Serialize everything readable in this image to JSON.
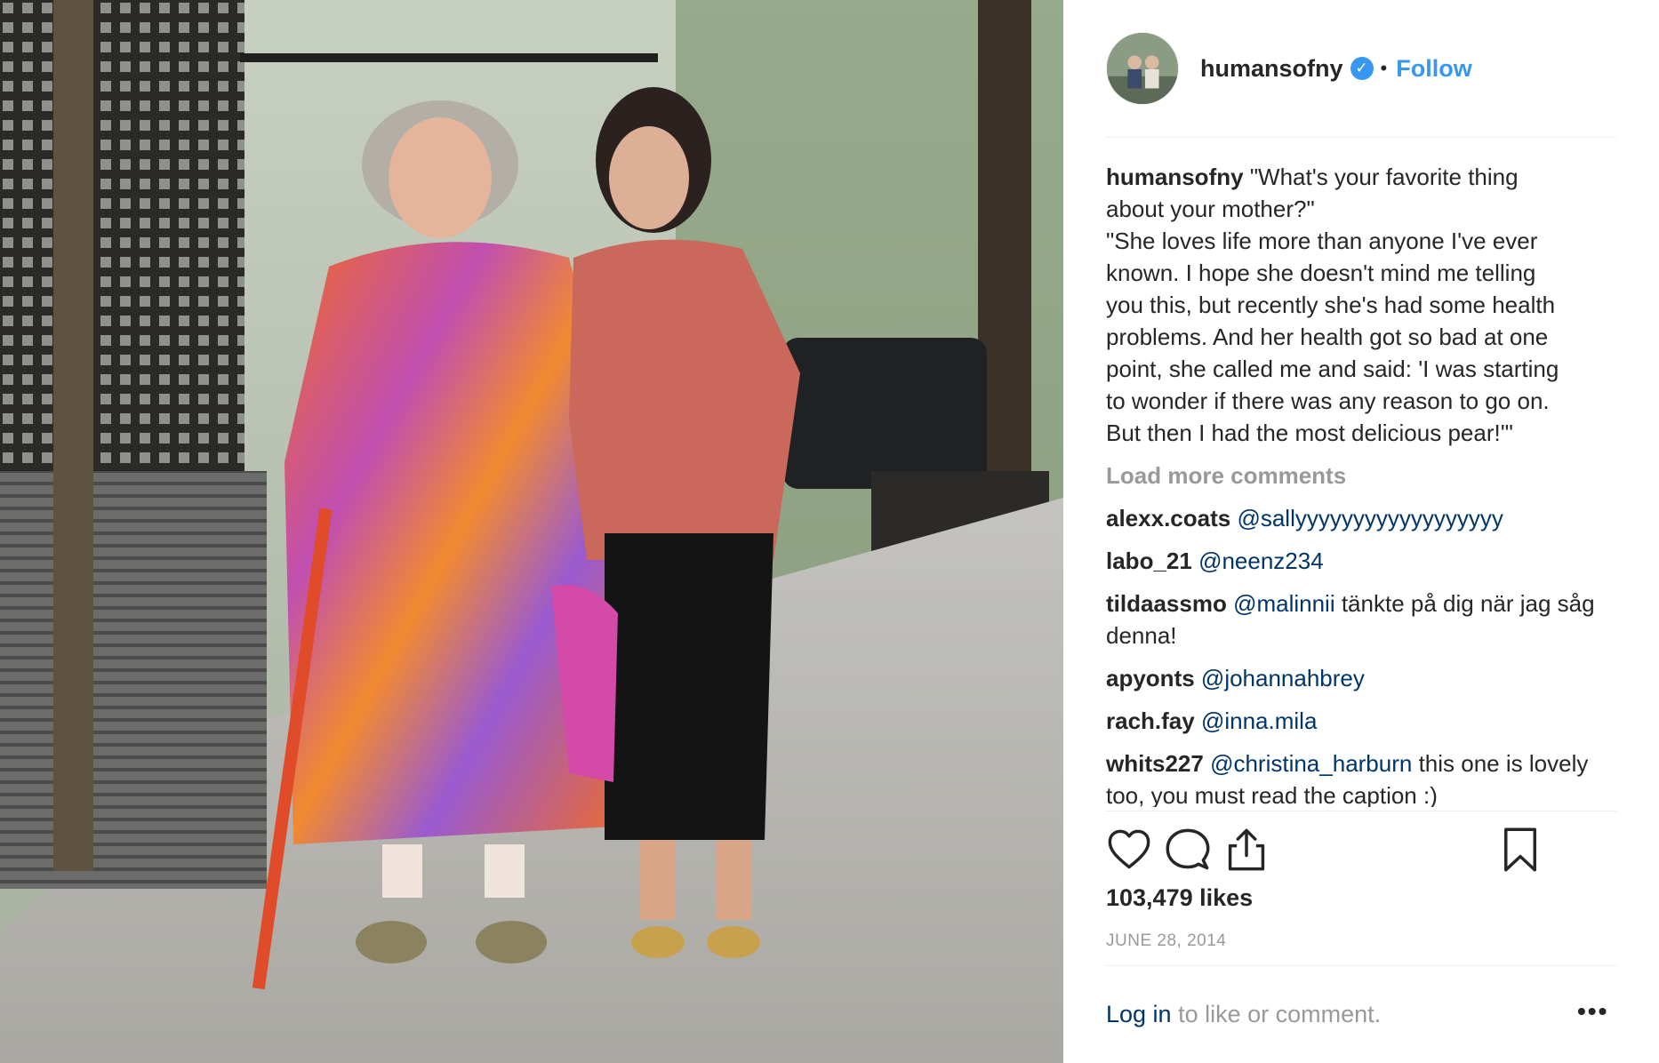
{
  "post": {
    "image_alt": "Two women standing on a sidewalk in New York",
    "account": {
      "username": "humansofny",
      "verified_icon": "verified-badge-icon",
      "separator": "•",
      "follow_label": "Follow"
    },
    "caption": {
      "username": "humansofny",
      "lines": [
        "\"What's your favorite thing",
        "about your mother?\"",
        "\"She loves life more than anyone I've ever",
        "known. I hope she doesn't mind me telling",
        "you this, but recently she's had some health",
        "problems. And her health got so bad at one",
        "point, she called me and said: 'I was starting",
        "to wonder if there was any reason to go on.",
        "But then I had the most delicious pear!'\""
      ]
    },
    "load_more_label": "Load more comments",
    "comments": [
      {
        "user": "alexx.coats",
        "mention": "@sallyyyyyyyyyyyyyyyyyy",
        "text": ""
      },
      {
        "user": "labo_21",
        "mention": "@neenz234",
        "text": ""
      },
      {
        "user": "tildaassmo",
        "mention": "@malinnii",
        "text": " tänkte på dig när jag såg denna!"
      },
      {
        "user": "apyonts",
        "mention": "@johannahbrey",
        "text": ""
      },
      {
        "user": "rach.fay",
        "mention": "@inna.mila",
        "text": ""
      },
      {
        "user": "whits227",
        "mention": "@christina_harburn",
        "text": " this one is lovely too, you must read the caption :)"
      }
    ],
    "actions": {
      "like_icon": "heart-icon",
      "comment_icon": "comment-icon",
      "share_icon": "share-icon",
      "save_icon": "bookmark-icon"
    },
    "likes": "103,479 likes",
    "date": "JUNE 28, 2014",
    "login": {
      "link": "Log in",
      "text": " to like or comment."
    },
    "more_options": "•••"
  },
  "colors": {
    "link_blue": "#3897f0",
    "mention_blue": "#003569",
    "muted": "#999999",
    "text": "#262626"
  }
}
